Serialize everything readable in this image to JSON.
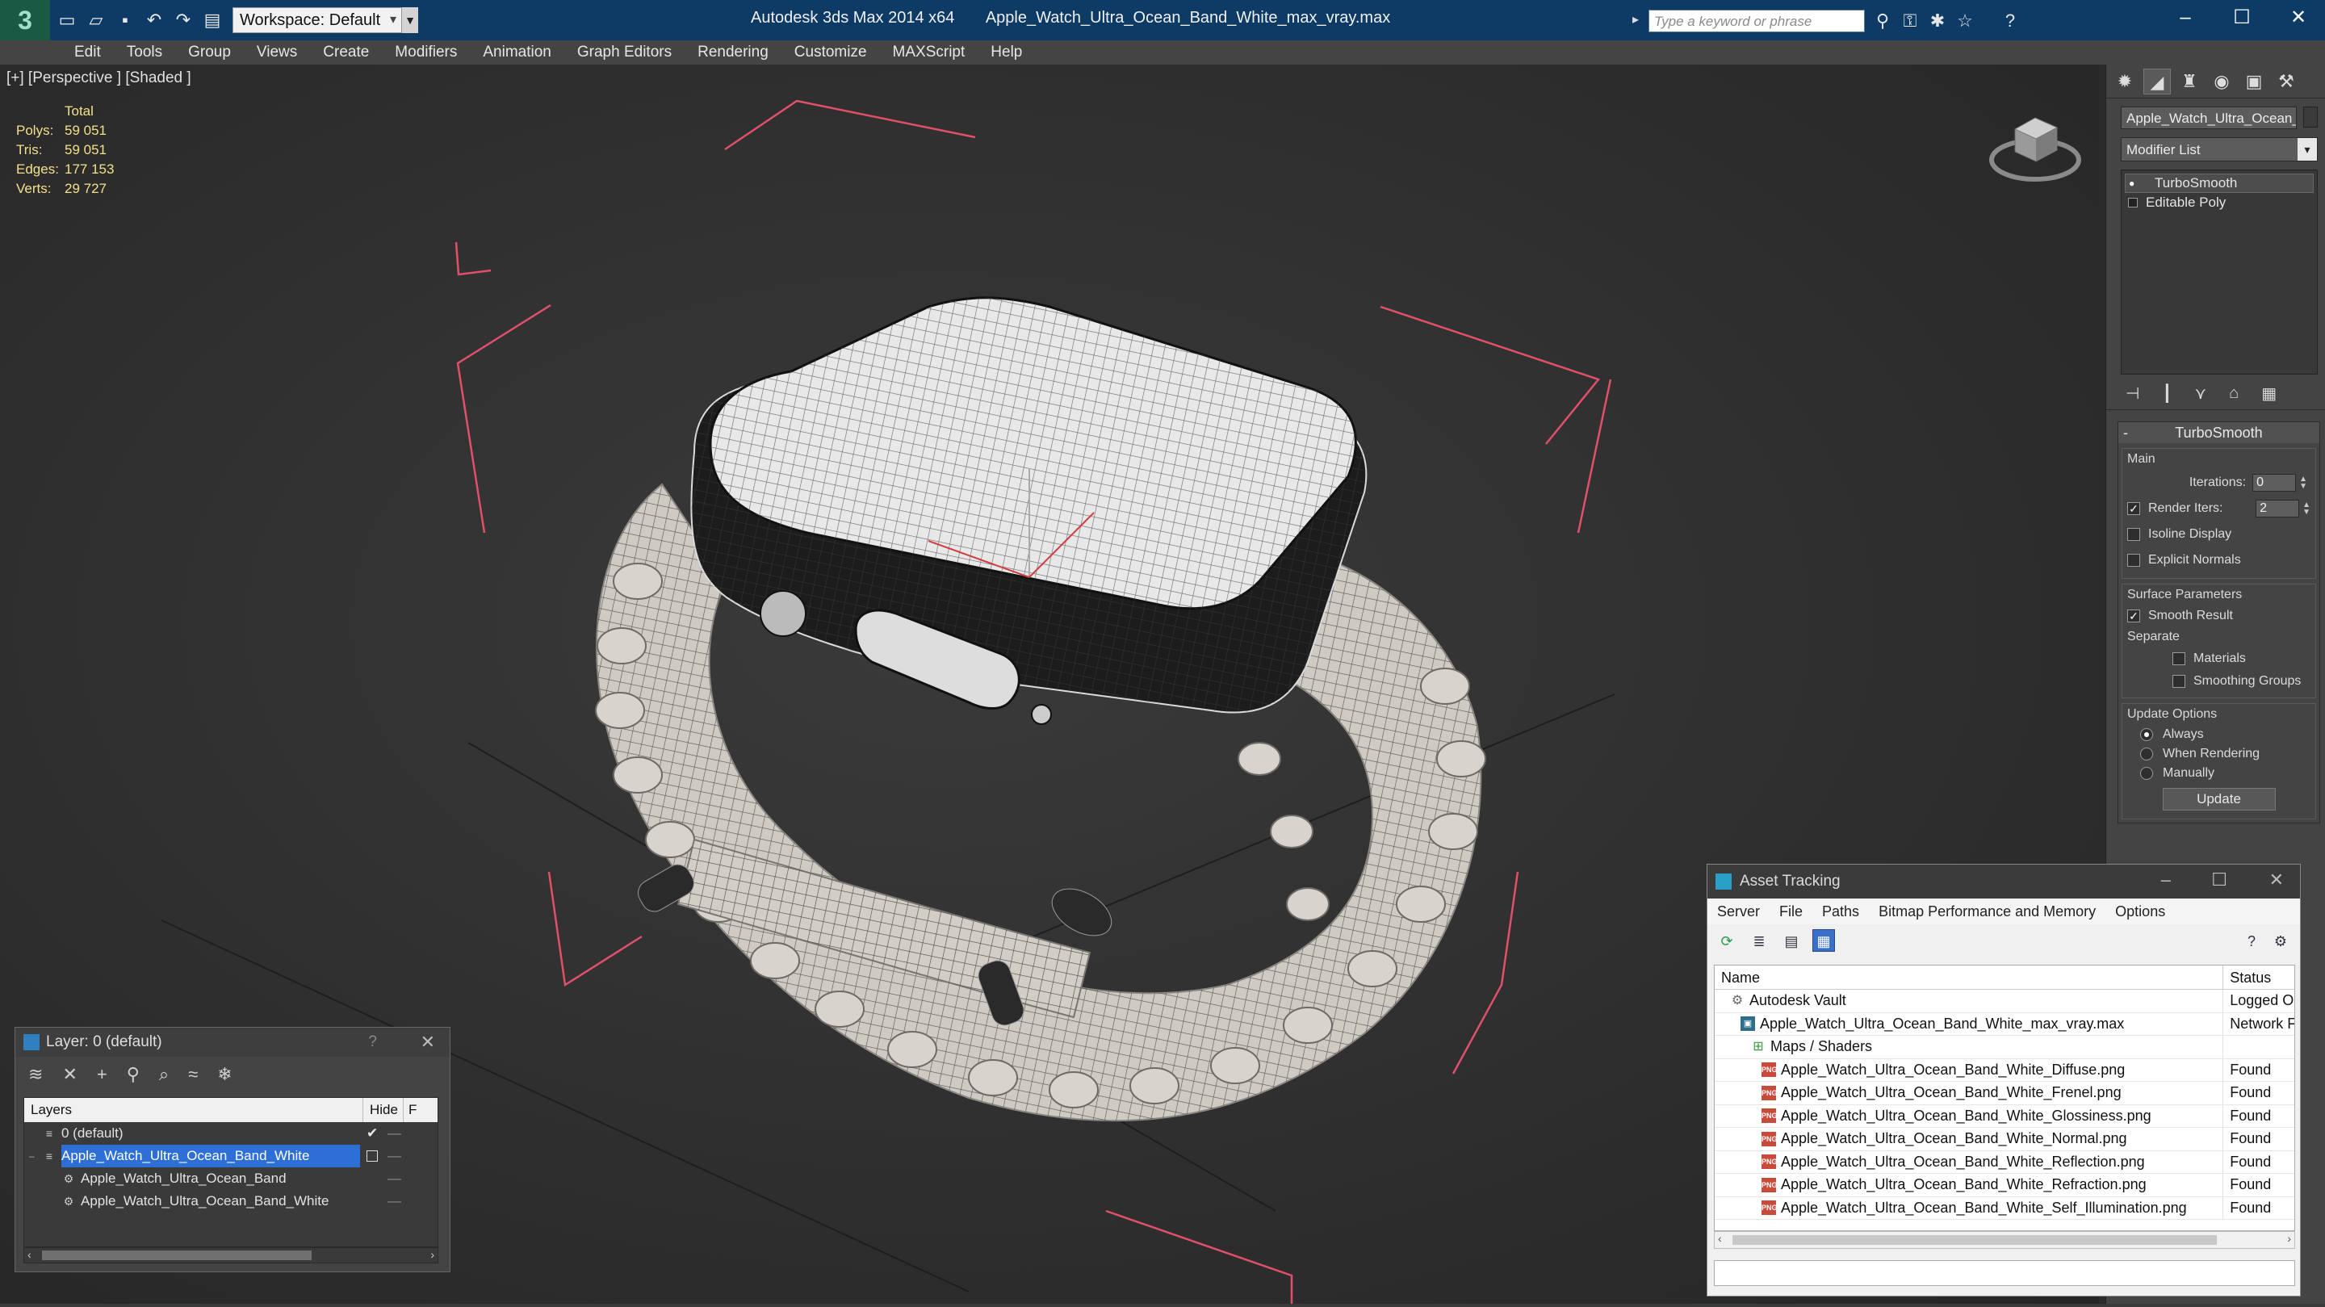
{
  "titlebar": {
    "app_title": "Autodesk 3ds Max  2014 x64",
    "file_title": "Apple_Watch_Ultra_Ocean_Band_White_max_vray.max",
    "workspace": "Workspace: Default",
    "search_placeholder": "Type a keyword or phrase"
  },
  "menu": [
    "Edit",
    "Tools",
    "Group",
    "Views",
    "Create",
    "Modifiers",
    "Animation",
    "Graph Editors",
    "Rendering",
    "Customize",
    "MAXScript",
    "Help"
  ],
  "viewport": {
    "label": "[+] [Perspective ] [Shaded ]",
    "stats": {
      "header": "Total",
      "rows": [
        {
          "k": "Polys:",
          "v": "59 051"
        },
        {
          "k": "Tris:",
          "v": "59 051"
        },
        {
          "k": "Edges:",
          "v": "177 153"
        },
        {
          "k": "Verts:",
          "v": "29 727"
        }
      ]
    }
  },
  "command_panel": {
    "object_name": "Apple_Watch_Ultra_Ocean_E",
    "modifier_list": "Modifier List",
    "stack": [
      "TurboSmooth",
      "Editable Poly"
    ],
    "rollout": "TurboSmooth",
    "main_group": "Main",
    "iterations_label": "Iterations:",
    "iterations_value": "0",
    "render_iters_label": "Render Iters:",
    "render_iters_value": "2",
    "isoline": "Isoline Display",
    "explicit_normals": "Explicit Normals",
    "surface_group": "Surface Parameters",
    "smooth_result": "Smooth Result",
    "separate": "Separate",
    "materials": "Materials",
    "smoothing_groups": "Smoothing Groups",
    "update_group": "Update Options",
    "always": "Always",
    "when_rendering": "When Rendering",
    "manually": "Manually",
    "update_button": "Update"
  },
  "layer_dialog": {
    "title": "Layer: 0 (default)",
    "help": "?",
    "columns": [
      "Layers",
      "Hide",
      "F"
    ],
    "rows": [
      {
        "name": "0 (default)",
        "indent": 0
      },
      {
        "name": "Apple_Watch_Ultra_Ocean_Band_White",
        "indent": 0
      },
      {
        "name": "Apple_Watch_Ultra_Ocean_Band",
        "indent": 1
      },
      {
        "name": "Apple_Watch_Ultra_Ocean_Band_White",
        "indent": 1
      }
    ]
  },
  "asset_tracking": {
    "title": "Asset Tracking",
    "menu": [
      "Server",
      "File",
      "Paths",
      "Bitmap Performance and Memory",
      "Options"
    ],
    "columns": [
      "Name",
      "Status"
    ],
    "rows": [
      {
        "name": "Autodesk Vault",
        "status": "Logged O",
        "indent": 1,
        "icon": "vault"
      },
      {
        "name": "Apple_Watch_Ultra_Ocean_Band_White_max_vray.max",
        "status": "Network F",
        "indent": 2,
        "icon": "max"
      },
      {
        "name": "Maps / Shaders",
        "status": "",
        "indent": 3,
        "icon": "maps"
      },
      {
        "name": "Apple_Watch_Ultra_Ocean_Band_White_Diffuse.png",
        "status": "Found",
        "indent": 4,
        "icon": "png"
      },
      {
        "name": "Apple_Watch_Ultra_Ocean_Band_White_Frenel.png",
        "status": "Found",
        "indent": 4,
        "icon": "png"
      },
      {
        "name": "Apple_Watch_Ultra_Ocean_Band_White_Glossiness.png",
        "status": "Found",
        "indent": 4,
        "icon": "png"
      },
      {
        "name": "Apple_Watch_Ultra_Ocean_Band_White_Normal.png",
        "status": "Found",
        "indent": 4,
        "icon": "png"
      },
      {
        "name": "Apple_Watch_Ultra_Ocean_Band_White_Reflection.png",
        "status": "Found",
        "indent": 4,
        "icon": "png"
      },
      {
        "name": "Apple_Watch_Ultra_Ocean_Band_White_Refraction.png",
        "status": "Found",
        "indent": 4,
        "icon": "png"
      },
      {
        "name": "Apple_Watch_Ultra_Ocean_Band_White_Self_Illumination.png",
        "status": "Found",
        "indent": 4,
        "icon": "png"
      }
    ]
  },
  "colors": {
    "titlebar": "#0d3b66",
    "selection": "#2e6fd6",
    "stats_text": "#f4e08a",
    "bbox_lines": "#e0506a"
  }
}
